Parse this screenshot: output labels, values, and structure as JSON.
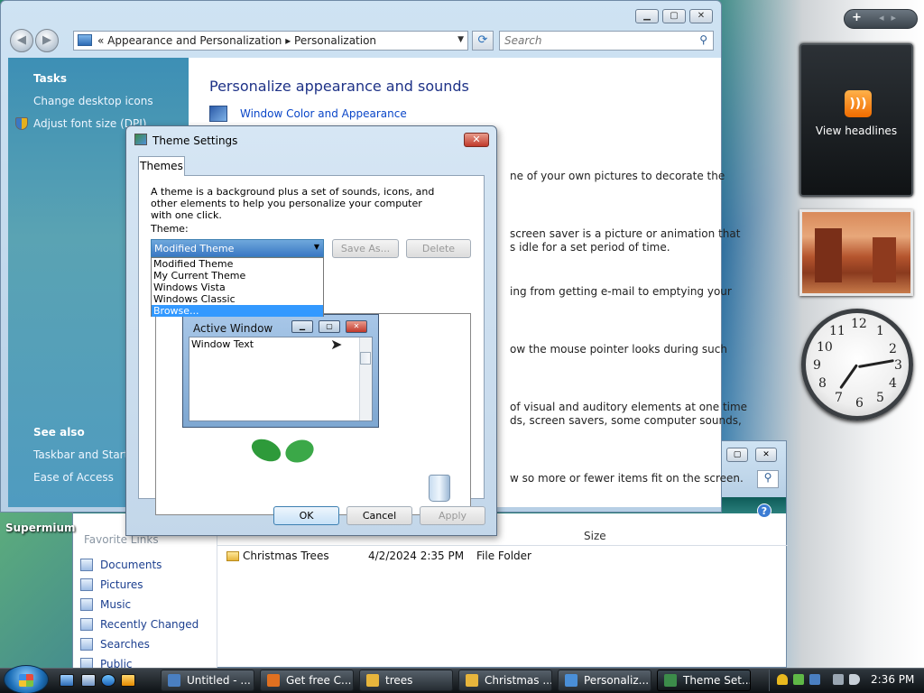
{
  "main_window": {
    "address_crumbs": "«  Appearance and Personalization  ▸  Personalization",
    "search_placeholder": "Search",
    "tasks_heading": "Tasks",
    "task_links": [
      "Change desktop icons",
      "Adjust font size (DPI)"
    ],
    "see_also_heading": "See also",
    "see_also_links": [
      "Taskbar and Start Menu",
      "Ease of Access"
    ],
    "page_title": "Personalize appearance and sounds",
    "first_link": "Window Color and Appearance",
    "descriptions": [
      "ne of your own pictures to decorate the",
      "screen saver is a picture or animation that",
      "s idle for a set period of time.",
      "ing from getting e-mail to emptying your",
      "ow the mouse pointer looks during such",
      "of visual and auditory elements at one time",
      "ds, screen savers, some computer sounds,",
      "w so more or fewer items fit on the screen."
    ]
  },
  "theme_dialog": {
    "title": "Theme Settings",
    "tab": "Themes",
    "description": "A theme is a background plus a set of sounds, icons, and other elements to help you personalize your computer with one click.",
    "theme_label": "Theme:",
    "selected_theme": "Modified Theme",
    "options": [
      "Modified Theme",
      "My Current Theme",
      "Windows Vista",
      "Windows Classic",
      "Browse..."
    ],
    "highlighted_option": "Browse...",
    "save_as": "Save As...",
    "delete": "Delete",
    "preview_window_title": "Active Window",
    "preview_window_text": "Window Text",
    "ok": "OK",
    "cancel": "Cancel",
    "apply": "Apply"
  },
  "explorer": {
    "favorite_links_heading": "Favorite Links",
    "favorites": [
      "Documents",
      "Pictures",
      "Music",
      "Recently Changed",
      "Searches",
      "Public"
    ],
    "columns": [
      "Size"
    ],
    "rows": [
      {
        "name": "Christmas Trees",
        "date": "4/2/2024 2:35 PM",
        "type": "File Folder"
      }
    ]
  },
  "desktop": {
    "icon_label": "Supermium"
  },
  "sidebar": {
    "rss_label": "View headlines",
    "clock_numbers": [
      "12",
      "1",
      "2",
      "3",
      "4",
      "5",
      "6",
      "7",
      "8",
      "9",
      "10",
      "11"
    ]
  },
  "taskbar": {
    "buttons": [
      {
        "label": "Untitled - ...",
        "icon_color": "#4a7fc1"
      },
      {
        "label": "Get free C...",
        "icon_color": "#e07020"
      },
      {
        "label": "trees",
        "icon_color": "#e7b53c"
      },
      {
        "label": "Christmas ...",
        "icon_color": "#e7b53c"
      },
      {
        "label": "Personaliz...",
        "icon_color": "#4a8fd8"
      },
      {
        "label": "Theme Set...",
        "icon_color": "#3c8c4a"
      }
    ],
    "active_button": "Theme Set...",
    "clock": "2:36 PM"
  }
}
